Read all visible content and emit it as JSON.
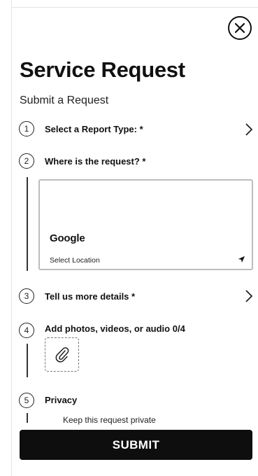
{
  "header": {
    "title": "Service Request",
    "subtitle": "Submit a Request",
    "close_icon": "close-circle-icon"
  },
  "steps": [
    {
      "number": "1",
      "label": "Select a Report Type: *",
      "has_chevron": true
    },
    {
      "number": "2",
      "label": "Where is the request? *",
      "has_chevron": false
    },
    {
      "number": "3",
      "label": "Tell us more details *",
      "has_chevron": true
    },
    {
      "number": "4",
      "label": "Add photos, videos, or audio 0/4",
      "has_chevron": false
    },
    {
      "number": "5",
      "label": "Privacy",
      "has_chevron": false
    }
  ],
  "map": {
    "logo_text": "Google",
    "placeholder": "Select Location",
    "icon": "navigation-arrow-icon"
  },
  "attachments": {
    "icon": "paperclip-icon"
  },
  "privacy": {
    "option_label": "Keep this request private"
  },
  "footer": {
    "submit_label": "SUBMIT"
  },
  "colors": {
    "button_bg": "#0e0e0e",
    "text": "#111111",
    "map_border": "#bdbdbd"
  }
}
